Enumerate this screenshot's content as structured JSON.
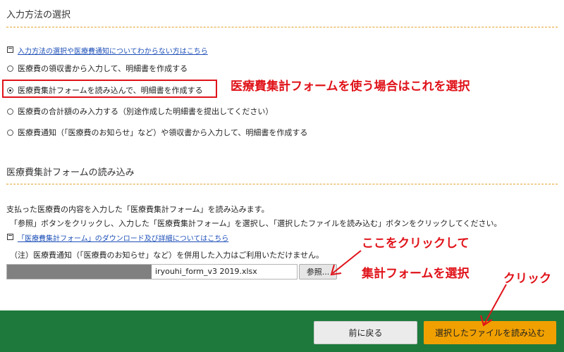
{
  "section1": {
    "title": "入力方法の選択",
    "help_link": "入力方法の選択や医療費通知についてわからない方はこちら",
    "options": [
      {
        "label": "医療費の領収書から入力して、明細書を作成する",
        "selected": false
      },
      {
        "label": "医療費集計フォームを読み込んで、明細書を作成する",
        "selected": true
      },
      {
        "label": "医療費の合計額のみ入力する（別途作成した明細書を提出してください）",
        "selected": false
      },
      {
        "label": "医療費通知（「医療費のお知らせ」など）や領収書から入力して、明細書を作成する",
        "selected": false
      }
    ]
  },
  "section2": {
    "title": "医療費集計フォームの読み込み",
    "desc1": "支払った医療費の内容を入力した「医療費集計フォーム」を読み込みます。",
    "desc2": "「参照」ボタンをクリックし、入力した「医療費集計フォーム」を選択し、「選択したファイルを読み込む」ボタンをクリックしてください。",
    "download_link": "「医療費集計フォーム」のダウンロード及び詳細についてはこちら",
    "note": "（注）医療費通知（「医療費のお知らせ」など）を併用した入力はご利用いただけません。",
    "file_name": "iryouhi_form_v3 2019.xlsx",
    "browse_label": "参照..."
  },
  "annotations": {
    "select_this": "医療費集計フォームを使う場合はこれを選択",
    "click_here": "ここをクリックして",
    "select_form": "集計フォームを選択",
    "click": "クリック"
  },
  "footer": {
    "back_label": "前に戻る",
    "load_label": "選択したファイルを読み込む"
  },
  "colors": {
    "accent_dotted": "#e3a32f",
    "annotation_red": "#e0131a",
    "footer_green": "#1d7a3c",
    "load_button": "#f0a000"
  }
}
